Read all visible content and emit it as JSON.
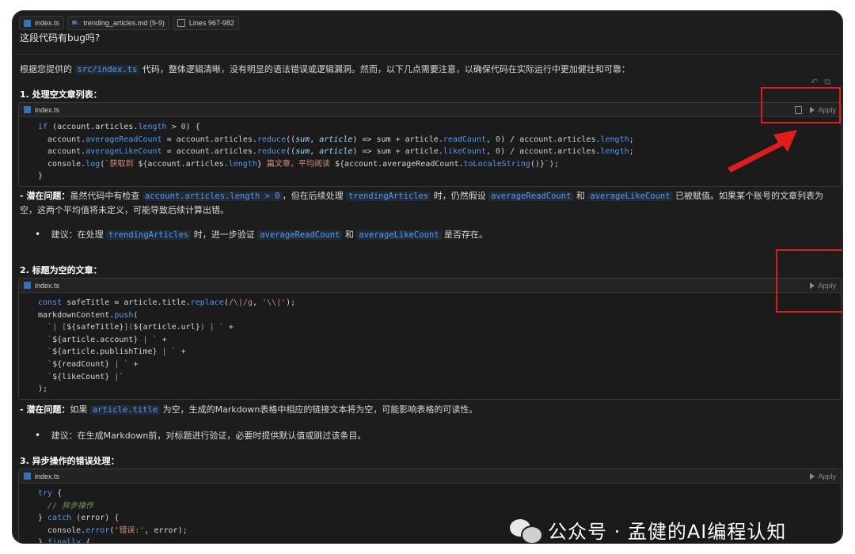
{
  "context_chips": [
    {
      "label": "index.ts",
      "icon": "typescript-file-icon"
    },
    {
      "label": "trending_articles.md (9-9)",
      "icon": "markdown-file-icon"
    },
    {
      "label": "Lines 967-982",
      "icon": "lines-icon"
    }
  ],
  "question": "这段代码有bug吗?",
  "intro": {
    "prefix": "根据您提供的",
    "code": "src/index.ts",
    "suffix": "代码，整体逻辑清晰，没有明显的语法错误或逻辑漏洞。然而，以下几点需要注意，以确保代码在实际运行中更加健壮和可靠："
  },
  "sections": [
    {
      "heading": "1. 处理空文章列表："
    },
    {
      "heading": "2. 标题为空的文章："
    },
    {
      "heading": "3. 异步操作的错误处理："
    }
  ],
  "code_blocks": [
    {
      "filename": "index.ts",
      "apply_label": "Apply"
    },
    {
      "filename": "index.ts",
      "apply_label": "Apply"
    },
    {
      "filename": "index.ts",
      "apply_label": "Apply"
    }
  ],
  "issue1": {
    "label": "- 潜在问题：",
    "t1": "虽然代码中有检查",
    "c1": "account.articles.length > 0",
    "t2": "，但在后续处理",
    "c2": "trendingArticles",
    "t3": "时，仍然假设",
    "c3": "averageReadCount",
    "t4": "和",
    "c4": "averageLikeCount",
    "t5": "已被赋值。如果某个账号的文章列表为空，这两个平均值将未定义，可能导致后续计算出错。"
  },
  "suggestion1": {
    "label": "建议",
    "t1": "：在处理",
    "c1": "trendingArticles",
    "t2": "时，进一步验证",
    "c2": "averageReadCount",
    "t3": "和",
    "c3": "averageLikeCount",
    "t4": "是否存在。"
  },
  "issue2": {
    "label": "- 潜在问题：",
    "t1": "如果",
    "c1": "article.title",
    "t2": "为空，生成的Markdown表格中相应的链接文本将为空，可能影响表格的可读性。"
  },
  "suggestion2": {
    "label": "建议",
    "t1": "：在生成Markdown前，对标题进行验证，必要时提供默认值或跳过该条目。"
  },
  "watermark": "公众号 · 孟健的AI编程认知",
  "colors": {
    "annotation_red": "#e21b1b",
    "background": "#1d1d1d",
    "code_accent": "#4f9bf0"
  }
}
